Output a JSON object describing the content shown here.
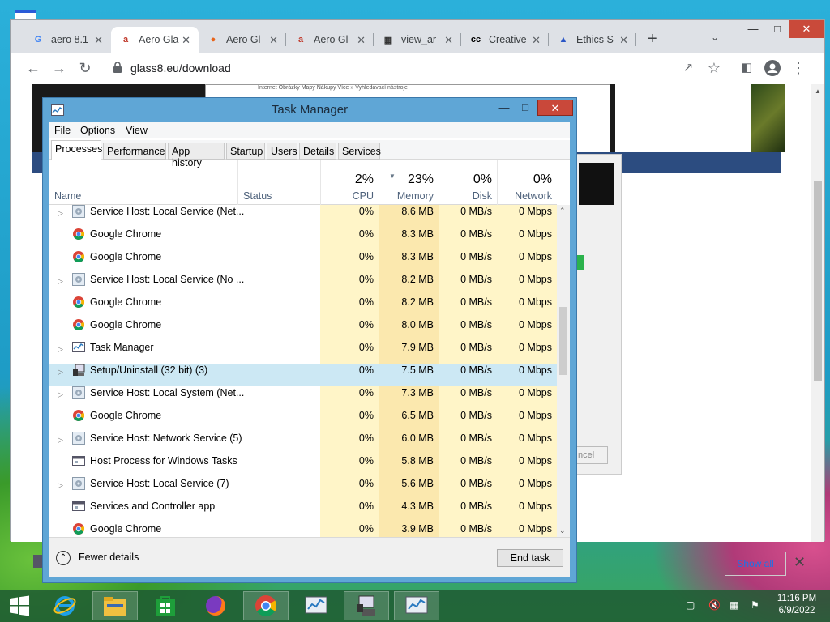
{
  "browser": {
    "tabs": [
      {
        "title": "aero 8.1",
        "favicon": "G"
      },
      {
        "title": "Aero Gla",
        "favicon": "aero"
      },
      {
        "title": "Aero Gl",
        "favicon": "fire"
      },
      {
        "title": "Aero Gl",
        "favicon": "aero"
      },
      {
        "title": "view_ar",
        "favicon": "archive"
      },
      {
        "title": "Creative",
        "favicon": "cc"
      },
      {
        "title": "Ethics S",
        "favicon": "ethics"
      }
    ],
    "url": "glass8.eu/download",
    "bg_menu": "Internet   Obrázky   Mapy   Nákupy   Více »   Vyhledávací nástroje",
    "bg_button_text": "ncel",
    "show_all": "Show all"
  },
  "task_manager": {
    "title": "Task Manager",
    "menu": [
      "File",
      "Options",
      "View"
    ],
    "tabs": [
      "Processes",
      "Performance",
      "App history",
      "Startup",
      "Users",
      "Details",
      "Services"
    ],
    "columns": {
      "name": "Name",
      "status": "Status",
      "cpu": {
        "pct": "2%",
        "label": "CPU"
      },
      "memory": {
        "pct": "23%",
        "label": "Memory"
      },
      "disk": {
        "pct": "0%",
        "label": "Disk"
      },
      "network": {
        "pct": "0%",
        "label": "Network"
      }
    },
    "rows": [
      {
        "name": "Service Host: Local Service (Net...",
        "icon": "gear",
        "expand": true,
        "cpu": "0%",
        "mem": "8.6 MB",
        "disk": "0 MB/s",
        "net": "0 Mbps"
      },
      {
        "name": "Google Chrome",
        "icon": "chrome",
        "expand": false,
        "cpu": "0%",
        "mem": "8.3 MB",
        "disk": "0 MB/s",
        "net": "0 Mbps"
      },
      {
        "name": "Google Chrome",
        "icon": "chrome",
        "expand": false,
        "cpu": "0%",
        "mem": "8.3 MB",
        "disk": "0 MB/s",
        "net": "0 Mbps"
      },
      {
        "name": "Service Host: Local Service (No ...",
        "icon": "gear",
        "expand": true,
        "cpu": "0%",
        "mem": "8.2 MB",
        "disk": "0 MB/s",
        "net": "0 Mbps"
      },
      {
        "name": "Google Chrome",
        "icon": "chrome",
        "expand": false,
        "cpu": "0%",
        "mem": "8.2 MB",
        "disk": "0 MB/s",
        "net": "0 Mbps"
      },
      {
        "name": "Google Chrome",
        "icon": "chrome",
        "expand": false,
        "cpu": "0%",
        "mem": "8.0 MB",
        "disk": "0 MB/s",
        "net": "0 Mbps"
      },
      {
        "name": "Task Manager",
        "icon": "taskmgr",
        "expand": true,
        "cpu": "0%",
        "mem": "7.9 MB",
        "disk": "0 MB/s",
        "net": "0 Mbps"
      },
      {
        "name": "Setup/Uninstall (32 bit) (3)",
        "icon": "setup",
        "expand": true,
        "selected": true,
        "cpu": "0%",
        "mem": "7.5 MB",
        "disk": "0 MB/s",
        "net": "0 Mbps"
      },
      {
        "name": "Service Host: Local System (Net...",
        "icon": "gear",
        "expand": true,
        "cpu": "0%",
        "mem": "7.3 MB",
        "disk": "0 MB/s",
        "net": "0 Mbps"
      },
      {
        "name": "Google Chrome",
        "icon": "chrome",
        "expand": false,
        "cpu": "0%",
        "mem": "6.5 MB",
        "disk": "0 MB/s",
        "net": "0 Mbps"
      },
      {
        "name": "Service Host: Network Service (5)",
        "icon": "gear",
        "expand": true,
        "cpu": "0%",
        "mem": "6.0 MB",
        "disk": "0 MB/s",
        "net": "0 Mbps"
      },
      {
        "name": "Host Process for Windows Tasks",
        "icon": "window",
        "expand": false,
        "cpu": "0%",
        "mem": "5.8 MB",
        "disk": "0 MB/s",
        "net": "0 Mbps"
      },
      {
        "name": "Service Host: Local Service (7)",
        "icon": "gear",
        "expand": true,
        "cpu": "0%",
        "mem": "5.6 MB",
        "disk": "0 MB/s",
        "net": "0 Mbps"
      },
      {
        "name": "Services and Controller app",
        "icon": "window",
        "expand": false,
        "cpu": "0%",
        "mem": "4.3 MB",
        "disk": "0 MB/s",
        "net": "0 Mbps"
      },
      {
        "name": "Google Chrome",
        "icon": "chrome",
        "expand": false,
        "cpu": "0%",
        "mem": "3.9 MB",
        "disk": "0 MB/s",
        "net": "0 Mbps"
      }
    ],
    "fewer_details": "Fewer details",
    "end_task": "End task"
  },
  "taskbar": {
    "time": "11:16 PM",
    "date": "6/9/2022",
    "items": [
      "start-icon",
      "ie-icon",
      "file-explorer-icon",
      "store-icon",
      "firefox-icon",
      "chrome-icon",
      "taskmgr-icon",
      "setup-icon",
      "taskmgr-icon"
    ]
  }
}
